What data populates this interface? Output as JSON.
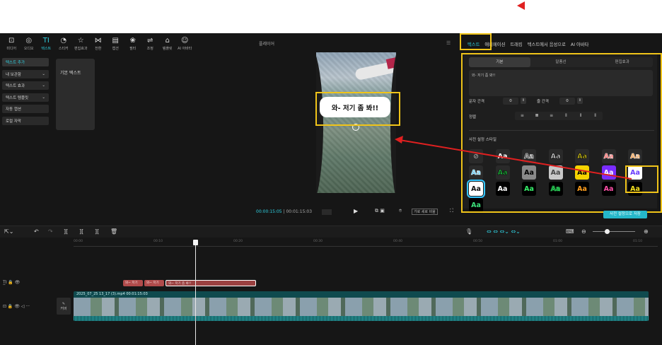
{
  "toolbar": {
    "items": [
      {
        "label": "미디어",
        "icon": "media-icon",
        "glyph": "⊡"
      },
      {
        "label": "오디오",
        "icon": "audio-icon",
        "glyph": "◎"
      },
      {
        "label": "텍스트",
        "icon": "text-icon",
        "glyph": "TI",
        "active": true
      },
      {
        "label": "스티커",
        "icon": "sticker-icon",
        "glyph": "◔"
      },
      {
        "label": "편집효과",
        "icon": "effects-icon",
        "glyph": "☆"
      },
      {
        "label": "전환",
        "icon": "transition-icon",
        "glyph": "⋈"
      },
      {
        "label": "캡션",
        "icon": "caption-icon",
        "glyph": "▤"
      },
      {
        "label": "필터",
        "icon": "filter-icon",
        "glyph": "❀"
      },
      {
        "label": "조정",
        "icon": "adjust-icon",
        "glyph": "⇌"
      },
      {
        "label": "템플릿",
        "icon": "template-icon",
        "glyph": "⌂"
      },
      {
        "label": "AI 아바타",
        "icon": "ai-avatar-icon",
        "glyph": "☺"
      }
    ]
  },
  "sidebar": {
    "items": [
      {
        "label": "텍스트 추가",
        "active": true,
        "dropdown": false
      },
      {
        "label": "내 보관함",
        "dropdown": true
      },
      {
        "label": "텍스트 효과",
        "dropdown": true
      },
      {
        "label": "텍스트 템플릿",
        "dropdown": true
      },
      {
        "label": "자동 캡션",
        "dropdown": false
      },
      {
        "label": "로컬 자막",
        "dropdown": false
      }
    ]
  },
  "library": {
    "card_label": "기본 텍스트"
  },
  "player": {
    "title": "플레이어",
    "overlay_text": "와- 저기 좀 봐!!",
    "current_time": "00:00:15:05",
    "total_time": "00:01:15:03",
    "ratio_label": "가로 세로 비율"
  },
  "right": {
    "tabs": [
      {
        "label": "텍스트",
        "active": true
      },
      {
        "label": "애니메이션"
      },
      {
        "label": "트래킹"
      },
      {
        "label": "텍스트에서 음성으로"
      },
      {
        "label": "AI 아바타"
      }
    ],
    "subtabs": [
      {
        "label": "기본",
        "active": true
      },
      {
        "label": "말풍선"
      },
      {
        "label": "편집효과"
      }
    ],
    "text_value": "와- 저기 좀 봐!!",
    "char_spacing_label": "문자 간격",
    "char_spacing": "0",
    "line_spacing_label": "줄 간격",
    "line_spacing": "0",
    "align_label": "정렬",
    "preset_label": "사전 설정 스타일",
    "apply_button": "사전 설정으로 저장",
    "presets": [
      {
        "t": "⊘",
        "bg": "#2a2a2a",
        "fg": "#999",
        "stroke": "none"
      },
      {
        "t": "Aa",
        "bg": "#2a2a2a",
        "fg": "#ffffff",
        "stroke": "none"
      },
      {
        "t": "Aa",
        "bg": "#2a2a2a",
        "fg": "#222",
        "stroke": "#ffffff"
      },
      {
        "t": "Aa",
        "bg": "#2a2a2a",
        "fg": "#ffffff",
        "stroke": "#000"
      },
      {
        "t": "Aa",
        "bg": "#2a2a2a",
        "fg": "#f2e21e",
        "stroke": "#000"
      },
      {
        "t": "Aa",
        "bg": "#2a2a2a",
        "fg": "#ff3b3b",
        "stroke": "#fff"
      },
      {
        "t": "Aa",
        "bg": "#2a2a2a",
        "fg": "#ff8a1e",
        "stroke": "#fff"
      },
      {
        "t": "Aa",
        "bg": "#2a2a2a",
        "fg": "#3ec3ff",
        "stroke": "#fff"
      },
      {
        "t": "Aa",
        "bg": "#2a2a2a",
        "fg": "#24e04a",
        "stroke": "#000"
      },
      {
        "t": "Aa",
        "bg": "#8a8a8a",
        "fg": "#000",
        "stroke": "none"
      },
      {
        "t": "Aa",
        "bg": "#c9c9c9",
        "fg": "#444",
        "stroke": "none"
      },
      {
        "t": "Aa",
        "bg": "#f5d300",
        "fg": "#000",
        "stroke": "none"
      },
      {
        "t": "Aa",
        "bg": "#7a2cff",
        "fg": "#fff",
        "stroke": "none"
      },
      {
        "t": "Aa",
        "bg": "#ffffff",
        "fg": "#6a3cff",
        "stroke": "none"
      },
      {
        "t": "Aa",
        "bg": "#ffffff",
        "fg": "#111",
        "stroke": "none",
        "selected": true
      },
      {
        "t": "Aa",
        "bg": "#000",
        "fg": "#ffffff",
        "stroke": "none"
      },
      {
        "t": "Aa",
        "bg": "#000",
        "fg": "#36f06a",
        "stroke": "none"
      },
      {
        "t": "Aa",
        "bg": "#000",
        "fg": "#117a2a",
        "stroke": "#36f06a"
      },
      {
        "t": "Aa",
        "bg": "#000",
        "fg": "#ff9f1e",
        "stroke": "none"
      },
      {
        "t": "Aa",
        "bg": "#000",
        "fg": "#ff4fa8",
        "stroke": "none"
      },
      {
        "t": "Aa",
        "bg": "#000",
        "fg": "#f5e21e",
        "stroke": "none"
      },
      {
        "t": "Aa",
        "bg": "#000",
        "fg": "#3ce07a",
        "stroke": "none"
      }
    ]
  },
  "timeline": {
    "ruler": [
      "00:00",
      "00:10",
      "00:20",
      "00:30",
      "00:40",
      "00:50",
      "01:00",
      "01:10"
    ],
    "text_clips": [
      {
        "label": "와~ 저기"
      },
      {
        "label": "와~ 저기"
      },
      {
        "label": "와~ 저기 좀 봐!!",
        "selected": true
      }
    ],
    "video_label": "2025_07_25 13_17 (3).mp4  00:01:15:03",
    "cover_label": "커버"
  },
  "colors": {
    "accent": "#2fd0e0",
    "highlight": "#f0c419",
    "arrow": "#e02020"
  }
}
